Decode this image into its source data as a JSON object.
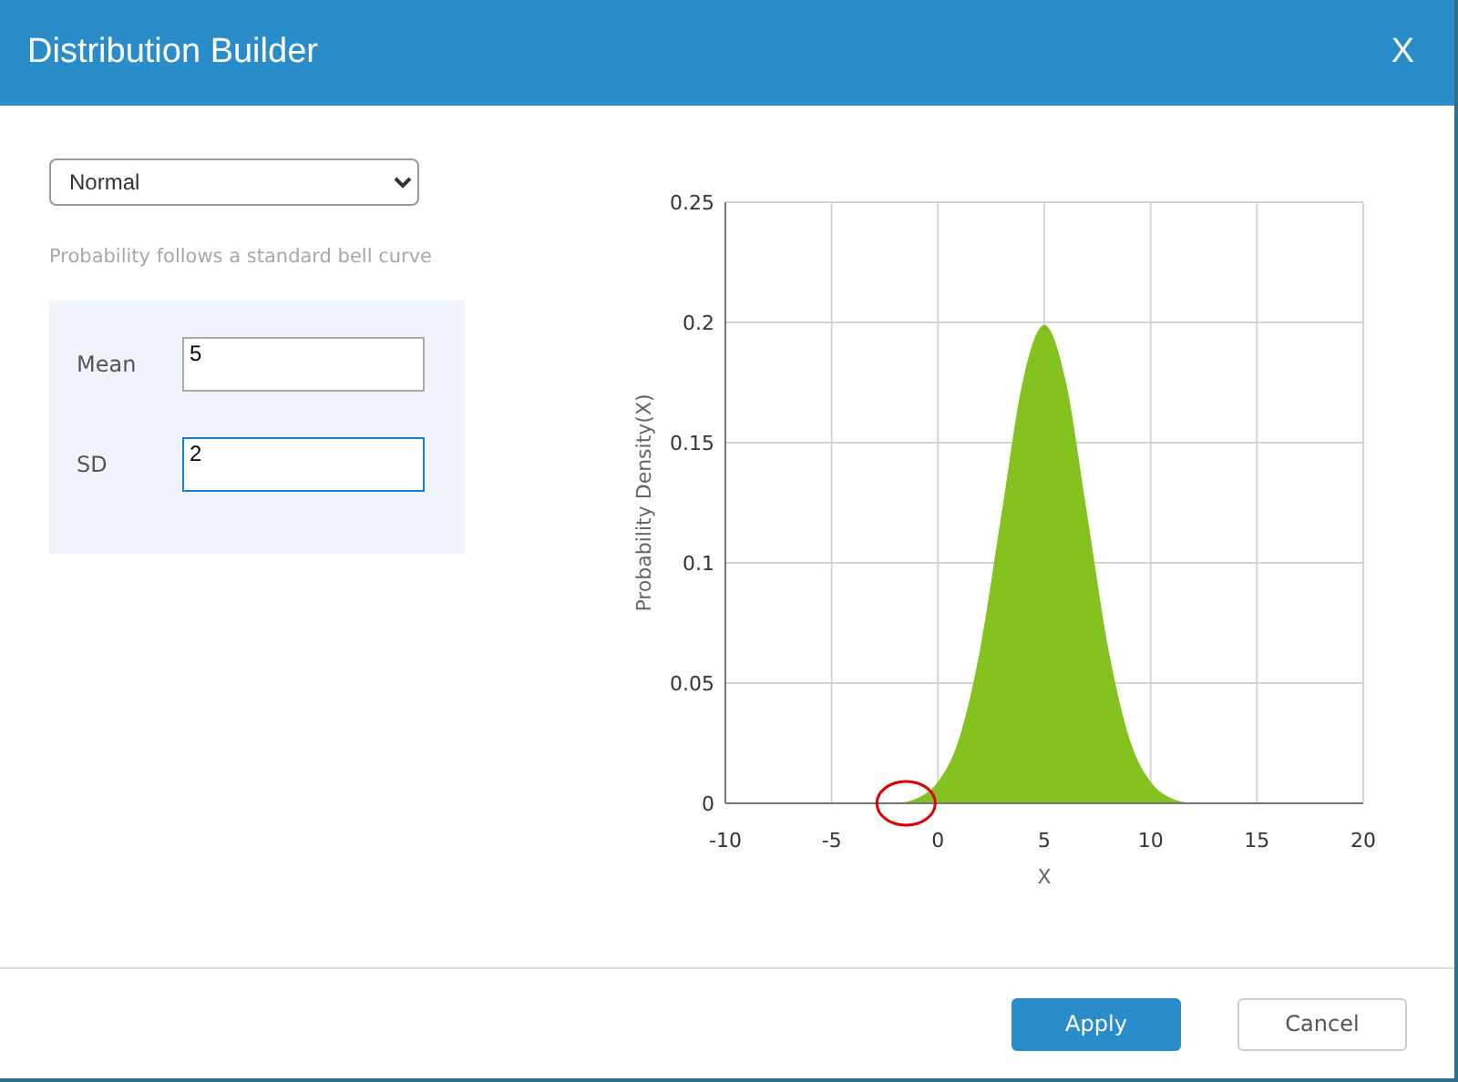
{
  "window": {
    "title": "Distribution Builder",
    "close": "X"
  },
  "distribution": {
    "value": "Normal",
    "description": "Probability follows a standard bell curve"
  },
  "parameters": [
    {
      "label": "Mean",
      "value": "5",
      "focused": false
    },
    {
      "label": "SD",
      "value": "2",
      "focused": true
    }
  ],
  "chart": {
    "chart_data": {
      "type": "area",
      "xlabel": "X",
      "ylabel": "Probability Density(X)",
      "x": [
        -2,
        -1,
        0,
        1,
        2,
        3,
        4,
        5,
        6,
        7,
        8,
        9,
        10,
        11,
        12
      ],
      "series": [
        {
          "color": "#83c21f",
          "values": [
            0,
            0.002,
            0.009,
            0.027,
            0.065,
            0.121,
            0.176,
            0.199,
            0.176,
            0.121,
            0.065,
            0.027,
            0.009,
            0.002,
            0
          ]
        }
      ],
      "grid": true,
      "xlim": [
        -10,
        20
      ],
      "ylim": [
        0,
        0.25
      ],
      "xticks": [
        -10,
        -5,
        0,
        5,
        10,
        15,
        20
      ],
      "yticks": [
        0,
        0.05,
        0.1,
        0.15,
        0.2,
        0.25
      ]
    },
    "marker": {
      "kind": "circle",
      "color": "#e00000"
    }
  },
  "buttons": [
    {
      "label": "Apply",
      "kind": "primary"
    },
    {
      "label": "Cancel",
      "kind": "secondary"
    }
  ]
}
